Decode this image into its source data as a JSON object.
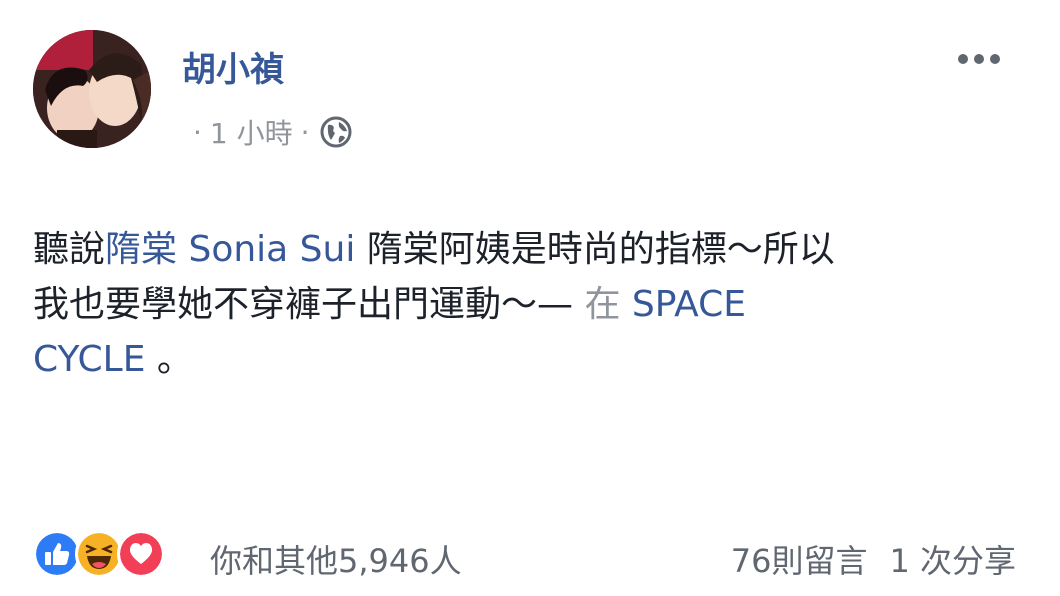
{
  "post": {
    "author": "胡小禎",
    "time": "1 小時",
    "dot1": "·",
    "dot2": "·",
    "privacy_icon": "globe-icon",
    "more_icon": "more-options-icon",
    "text": {
      "part1": "聽說",
      "tag1": "隋棠",
      "space1": " ",
      "tag2": "Sonia Sui",
      "part2": " 隋棠阿姨是時尚的指標～所以",
      "line2": "我也要學她不穿褲子出門運動～— ",
      "at": "在",
      "space2": " ",
      "location_line1": "SPACE",
      "location_line2": "CYCLE",
      "end": " 。"
    }
  },
  "footer": {
    "reaction_icons": [
      "like-icon",
      "haha-icon",
      "love-icon"
    ],
    "likers": "你和其他5,946人",
    "comments": "76則留言",
    "shares": "1 次分享"
  },
  "colors": {
    "link": "#365899",
    "meta": "#90949c",
    "like": "#2d7cf6",
    "haha": "#f7b125",
    "love": "#f33e58"
  }
}
